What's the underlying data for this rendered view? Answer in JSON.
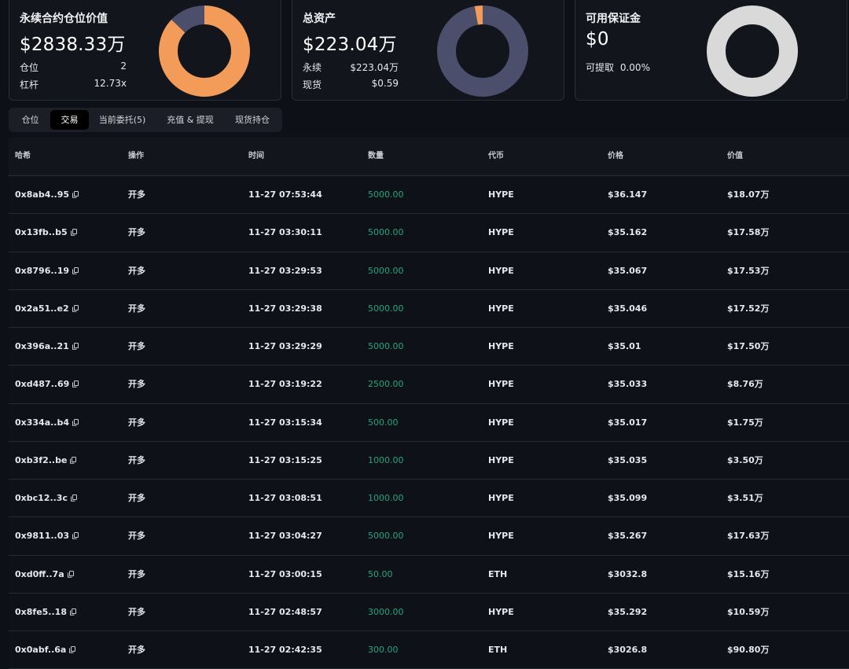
{
  "cards": {
    "perp": {
      "title": "永续合约仓位价值",
      "value": "$2838.33万",
      "rows": [
        {
          "label": "仓位",
          "value": "2"
        },
        {
          "label": "杠杆",
          "value": "12.73x"
        }
      ],
      "donut": {
        "segments": [
          {
            "fraction": 0.87,
            "color": "#f39c5a"
          },
          {
            "fraction": 0.13,
            "color": "#4c4f6b"
          }
        ]
      }
    },
    "total": {
      "title": "总资产",
      "value": "$223.04万",
      "rows": [
        {
          "label": "永续",
          "value": "$223.04万"
        },
        {
          "label": "现货",
          "value": "$0.59"
        }
      ],
      "donut": {
        "segments": [
          {
            "fraction": 0.97,
            "color": "#4c4f6b"
          },
          {
            "fraction": 0.03,
            "color": "#f39c5a"
          }
        ]
      }
    },
    "margin": {
      "title": "可用保证金",
      "value": "$0",
      "withdraw_label": "可提取",
      "withdraw_value": "0.00%",
      "donut": {
        "segments": [
          {
            "fraction": 1.0,
            "color": "#d9d9d9"
          }
        ]
      }
    }
  },
  "tabs": [
    {
      "label": "仓位",
      "active": false
    },
    {
      "label": "交易",
      "active": true
    },
    {
      "label": "当前委托(5)",
      "active": false
    },
    {
      "label": "充值 & 提现",
      "active": false
    },
    {
      "label": "现货持仓",
      "active": false
    }
  ],
  "table": {
    "columns": [
      "哈希",
      "操作",
      "时间",
      "数量",
      "代币",
      "价格",
      "价值"
    ],
    "rows": [
      [
        "0x8ab4..95",
        "开多",
        "11-27 07:53:44",
        "5000.00",
        "HYPE",
        "$36.147",
        "$18.07万"
      ],
      [
        "0x13fb..b5",
        "开多",
        "11-27 03:30:11",
        "5000.00",
        "HYPE",
        "$35.162",
        "$17.58万"
      ],
      [
        "0x8796..19",
        "开多",
        "11-27 03:29:53",
        "5000.00",
        "HYPE",
        "$35.067",
        "$17.53万"
      ],
      [
        "0x2a51..e2",
        "开多",
        "11-27 03:29:38",
        "5000.00",
        "HYPE",
        "$35.046",
        "$17.52万"
      ],
      [
        "0x396a..21",
        "开多",
        "11-27 03:29:29",
        "5000.00",
        "HYPE",
        "$35.01",
        "$17.50万"
      ],
      [
        "0xd487..69",
        "开多",
        "11-27 03:19:22",
        "2500.00",
        "HYPE",
        "$35.033",
        "$8.76万"
      ],
      [
        "0x334a..b4",
        "开多",
        "11-27 03:15:34",
        "500.00",
        "HYPE",
        "$35.017",
        "$1.75万"
      ],
      [
        "0xb3f2..be",
        "开多",
        "11-27 03:15:25",
        "1000.00",
        "HYPE",
        "$35.035",
        "$3.50万"
      ],
      [
        "0xbc12..3c",
        "开多",
        "11-27 03:08:51",
        "1000.00",
        "HYPE",
        "$35.099",
        "$3.51万"
      ],
      [
        "0x9811..03",
        "开多",
        "11-27 03:04:27",
        "5000.00",
        "HYPE",
        "$35.267",
        "$17.63万"
      ],
      [
        "0xd0ff..7a",
        "开多",
        "11-27 03:00:15",
        "50.00",
        "ETH",
        "$3032.8",
        "$15.16万"
      ],
      [
        "0x8fe5..18",
        "开多",
        "11-27 02:48:57",
        "3000.00",
        "HYPE",
        "$35.292",
        "$10.59万"
      ],
      [
        "0x0abf..6a",
        "开多",
        "11-27 02:42:35",
        "300.00",
        "ETH",
        "$3026.8",
        "$90.80万"
      ]
    ]
  }
}
